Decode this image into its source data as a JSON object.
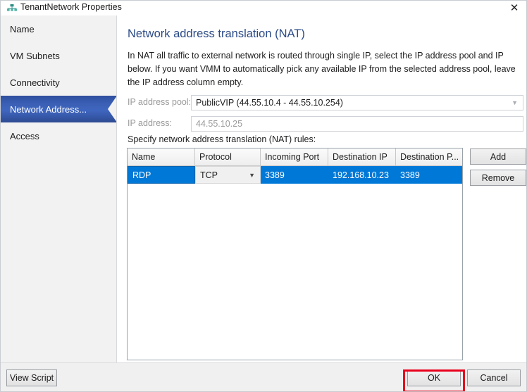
{
  "window": {
    "title": "TenantNetwork Properties",
    "icon": "network-properties-icon",
    "close_label": "✕"
  },
  "sidebar": {
    "items": [
      {
        "label": "Name",
        "selected": false
      },
      {
        "label": "VM Subnets",
        "selected": false
      },
      {
        "label": "Connectivity",
        "selected": false
      },
      {
        "label": "Network Address...",
        "selected": true
      },
      {
        "label": "Access",
        "selected": false
      }
    ]
  },
  "main": {
    "heading": "Network address translation (NAT)",
    "description": "In NAT all traffic to external network is routed through single IP, select the IP address pool and IP below. If you want VMM to automatically pick any available IP from the selected address pool, leave the IP address column empty.",
    "fields": [
      {
        "label": "IP address pool:",
        "value": "PublicVIP (44.55.10.4 - 44.55.10.254)",
        "type": "combobox",
        "caret": "▼"
      },
      {
        "label": "IP address:",
        "value": "44.55.10.25",
        "type": "textbox"
      }
    ],
    "rules_caption": "Specify network address translation (NAT) rules:",
    "grid": {
      "columns": [
        "Name",
        "Protocol",
        "Incoming Port",
        "Destination IP",
        "Destination P..."
      ],
      "rows": [
        {
          "selected": true,
          "cells": [
            "RDP",
            "TCP",
            "3389",
            "192.168.10.23",
            "3389"
          ]
        }
      ],
      "protocol_caret": "▼"
    },
    "side_buttons": [
      {
        "label": "Add"
      },
      {
        "label": "Remove"
      }
    ]
  },
  "footer": {
    "view_script_label": "View Script",
    "ok_label": "OK",
    "cancel_label": "Cancel"
  },
  "colors": {
    "heading": "#2b4a86",
    "nav_selected": "#3a5fb5",
    "row_selected": "#0078d7",
    "highlight": "#e8001c"
  }
}
